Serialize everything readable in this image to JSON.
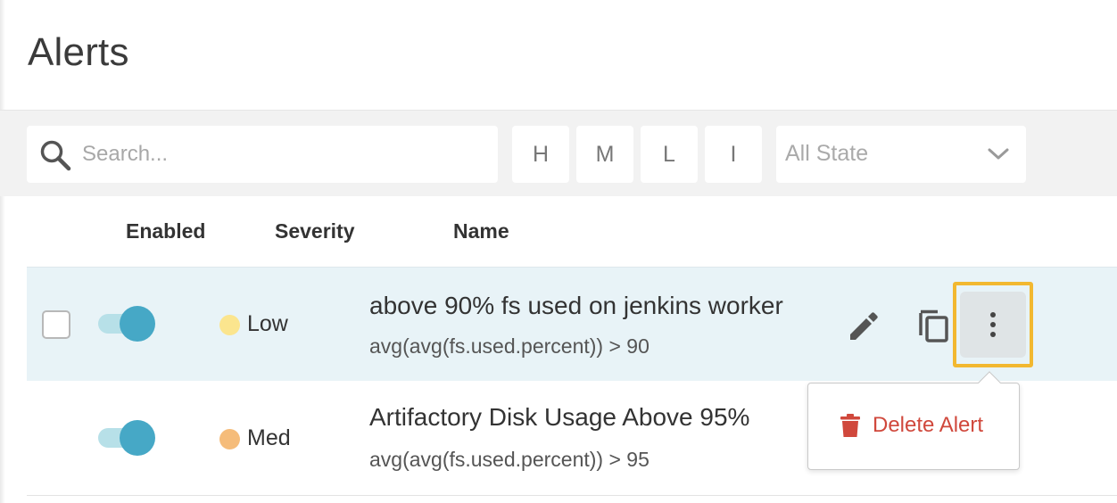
{
  "page": {
    "title": "Alerts"
  },
  "filters": {
    "search_placeholder": "Search...",
    "severity_buttons": [
      "H",
      "M",
      "L",
      "I"
    ],
    "state_select": {
      "value": "All State"
    }
  },
  "table": {
    "headers": {
      "enabled": "Enabled",
      "severity": "Severity",
      "name": "Name"
    },
    "rows": [
      {
        "enabled": true,
        "severity": "Low",
        "severity_color": "#fbe58e",
        "name": "above 90% fs used on jenkins worker",
        "query": "avg(avg(fs.used.percent)) > 90"
      },
      {
        "enabled": true,
        "severity": "Med",
        "severity_color": "#f5bc7a",
        "name": "Artifactory Disk Usage Above 95%",
        "query": "avg(avg(fs.used.percent)) > 95"
      }
    ]
  },
  "row_actions": {
    "edit_icon": "pencil-icon",
    "copy_icon": "copy-icon",
    "more_icon": "more-vertical-icon"
  },
  "context_menu": {
    "icon": "trash-icon",
    "delete_label": "Delete Alert"
  },
  "colors": {
    "accent": "#46a8c6",
    "toggle_track": "#b7e0e8",
    "highlight_border": "#f2b830",
    "danger": "#d0483c",
    "selected_row": "#e8f3f7"
  }
}
